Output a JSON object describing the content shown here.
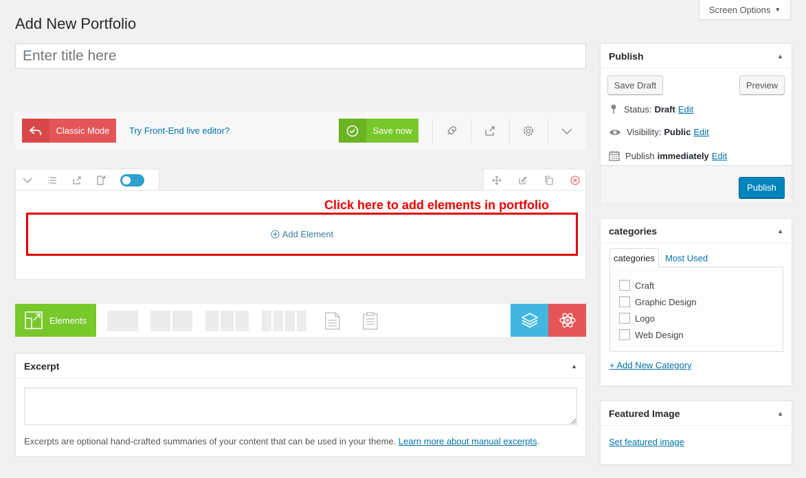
{
  "screen_options": {
    "label": "Screen Options"
  },
  "page": {
    "title": "Add New Portfolio"
  },
  "title_field": {
    "placeholder": "Enter title here",
    "value": ""
  },
  "composer": {
    "classic_mode": "Classic Mode",
    "frontend_link": "Try Front-End live editor?",
    "save_now": "Save now",
    "accent_green": "#78c72b",
    "accent_red": "#e65556"
  },
  "row": {
    "hint": "Click here to add elements in portfolio",
    "add_element": "Add Element"
  },
  "elements_bar": {
    "elements_label": "Elements"
  },
  "excerpt": {
    "title": "Excerpt",
    "value": "",
    "help_text": "Excerpts are optional hand-crafted summaries of your content that can be used in your theme.",
    "help_link": "Learn more about manual excerpts",
    "help_suffix": "."
  },
  "publish": {
    "title": "Publish",
    "save_draft": "Save Draft",
    "preview": "Preview",
    "status_label": "Status:",
    "status_value": "Draft",
    "visibility_label": "Visibility:",
    "visibility_value": "Public",
    "publish_label": "Publish",
    "publish_value": "immediately",
    "edit": "Edit",
    "publish_button": "Publish"
  },
  "categories": {
    "title": "categories",
    "tab_all": "categories",
    "tab_most_used": "Most Used",
    "items": [
      "Craft",
      "Graphic Design",
      "Logo",
      "Web Design"
    ],
    "add_new": "+ Add New Category"
  },
  "featured_image": {
    "title": "Featured Image",
    "set_link": "Set featured image"
  }
}
